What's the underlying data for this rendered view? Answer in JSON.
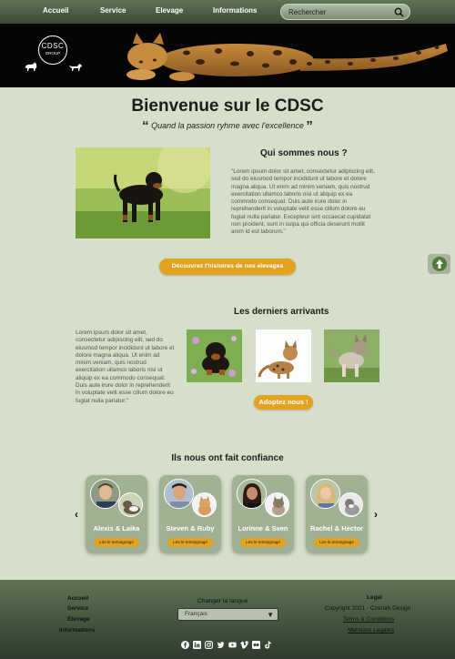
{
  "nav": {
    "items": [
      "Accueil",
      "Service",
      "Elevage",
      "Informations"
    ],
    "search_placeholder": "Rechercher"
  },
  "logo": {
    "line1": "CDSC",
    "line2": "GROUP"
  },
  "intro": {
    "title": "Bienvenue sur le CDSC",
    "quote_open": "“",
    "quote": "Quand la passion ryhme avec l'excellence",
    "quote_close": "”"
  },
  "about": {
    "heading": "Qui sommes nous ?",
    "text": "\"Lorem ipsum dolor sit amet, consectetur adipiscing elit, sed do eiusmod tempor incididunt ut labore et dolore magna aliqua. Ut enim ad minim veniam, quis nostrud exercitation ullamco laboris nisi ut aliquip ex ea commodo consequat. Duis aute irure dolor in reprehenderit in voluptate velit esse cillum dolore eu fugiat nulla pariatur. Excepteur sint occaecat cupidatat non proident, sunt in culpa qui officia deserunt mollit anim id est laborum.\"",
    "button": "Découvrez l'histoires de nos elevages"
  },
  "arrivals": {
    "heading": "Les derniers arrivants",
    "text": "Lorem ipsum dolor sit amet, consectetur adipiscing elit, sed do eiusmod tempor incididunt ut labore et dolore magna aliqua. Ut enim ad minim veniam, quis nostrud exercitation ullamco laboris nisi ut aliquip ex ea commodo consequat. Duis aute irure dolor in reprehenderit in voluptate velit esse cillum dolore eu fugiat nulla pariatur.\"",
    "button": "Adoptez nous !"
  },
  "testimonials": {
    "heading": "Ils nous ont fait confiance",
    "prev": "‹",
    "next": "›",
    "cards": [
      {
        "name": "Alexis & Laika",
        "button": "Lire le temoignage"
      },
      {
        "name": "Steven & Ruby",
        "button": "Lire le temoignage"
      },
      {
        "name": "Lorinne & Sven",
        "button": "Lire le temoignage"
      },
      {
        "name": "Rachel & Hector",
        "button": "Lire le temoignage"
      }
    ]
  },
  "footer": {
    "links": [
      "Accueil",
      "Service",
      "Elevage",
      "Informations"
    ],
    "lang_label": "Changer la langue",
    "lang_value": "Français",
    "legal_title": "Legal",
    "copyright": "Copyright 2021 - Czeriah Design",
    "terms": "Terms & Conditions",
    "mentions": "Mentions Legales",
    "social_icons": [
      "facebook-icon",
      "linkedin-icon",
      "instagram-icon",
      "twitter-icon",
      "youtube-icon",
      "vimeo-icon",
      "flickr-icon",
      "tiktok-icon"
    ]
  },
  "colors": {
    "background": "#d6dfc9",
    "nav": "#4b5d45",
    "accent": "#e3a21f",
    "card": "#a0b293"
  }
}
